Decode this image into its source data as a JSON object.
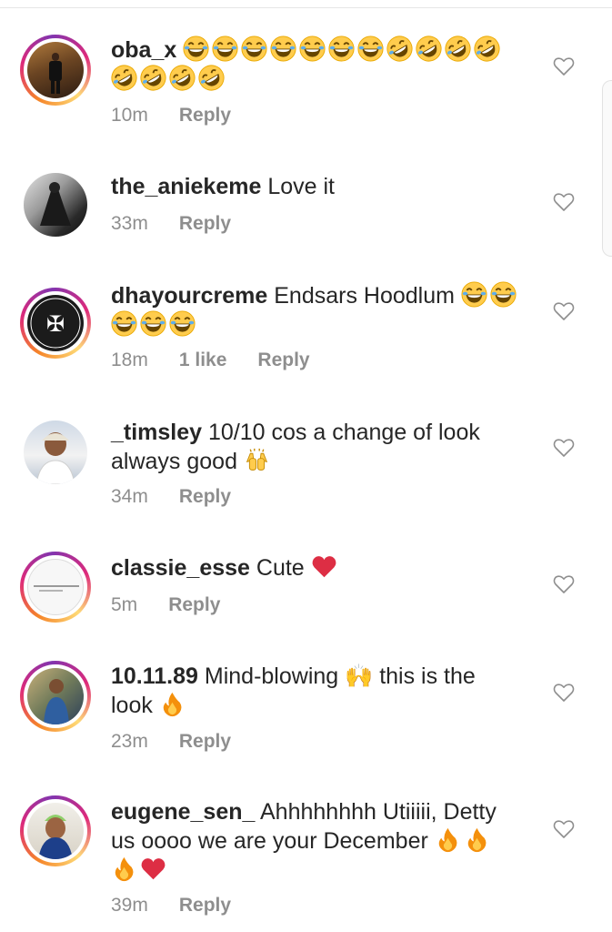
{
  "comments": [
    {
      "username": "oba_x",
      "text": "",
      "emojis": "😂😂😂😂😂😂😂🤣🤣🤣🤣🤣🤣🤣🤣",
      "time": "10m",
      "likes": "",
      "reply": "Reply"
    },
    {
      "username": "the_aniekeme",
      "text": "Love it",
      "emojis": "",
      "time": "33m",
      "likes": "",
      "reply": "Reply"
    },
    {
      "username": "dhayourcreme",
      "text": "Endsars Hoodlum",
      "emojis": "😂😂😂😂😂",
      "time": "18m",
      "likes": "1 like",
      "reply": "Reply"
    },
    {
      "username": "_timsley",
      "text": "10/10 cos a change of look always good",
      "emojis": "🙌",
      "time": "34m",
      "likes": "",
      "reply": "Reply"
    },
    {
      "username": "classie_esse",
      "text": "Cute",
      "emojis": "❤️",
      "time": "5m",
      "likes": "",
      "reply": "Reply"
    },
    {
      "username": "10.11.89",
      "text": "Mind-blowing 🙌 this is the look",
      "emojis": "🔥",
      "time": "23m",
      "likes": "",
      "reply": "Reply"
    },
    {
      "username": "eugene_sen_",
      "text": "Ahhhhhhhh Utiiiii, Detty us oooo we are your December",
      "emojis": "🔥🔥🔥❤️",
      "time": "39m",
      "likes": "",
      "reply": "Reply"
    }
  ],
  "icons": {
    "like": "heart-outline-icon"
  },
  "colors": {
    "meta": "#8e8e8e",
    "heart_red": "#e0162b",
    "fire": "#f5a623",
    "laugh": "#ffcc4d"
  }
}
